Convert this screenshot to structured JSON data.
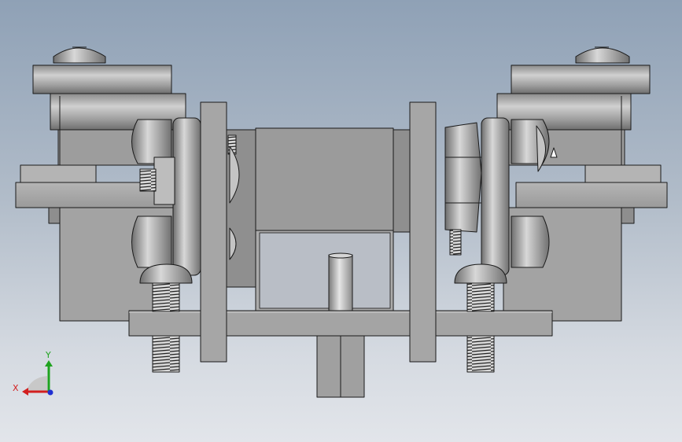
{
  "viewport": {
    "background_top": "#8fa1b6",
    "background_bottom": "#e2e5ea"
  },
  "model": {
    "part_fill": "#a9a9a9",
    "part_fill_dark": "#7c7c7c",
    "part_fill_light": "#c9c9c9",
    "edge_color": "#1a1a1a"
  },
  "triad": {
    "x_label": "X",
    "y_label": "Y",
    "x_color": "#d21f1f",
    "y_color": "#1fa31f",
    "z_color": "#1f2fd2",
    "icon": "coordinate-triad-icon"
  }
}
